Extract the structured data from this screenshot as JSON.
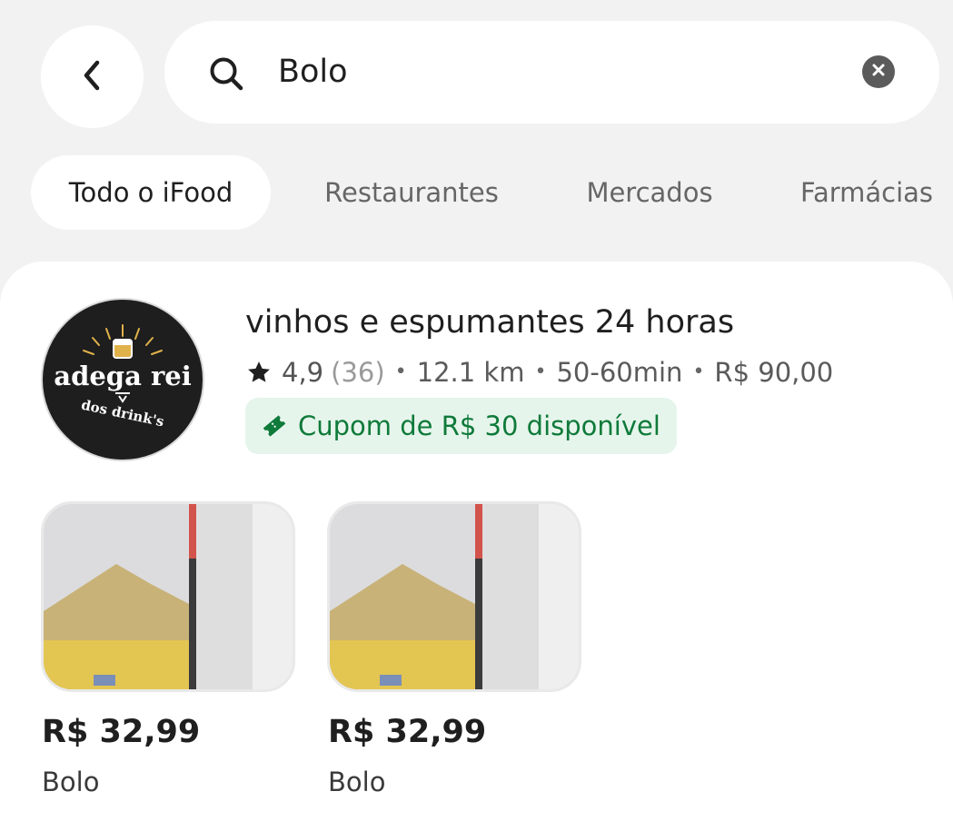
{
  "search": {
    "query": "Bolo"
  },
  "tabs": [
    "Todo o iFood",
    "Restaurantes",
    "Mercados",
    "Farmácias"
  ],
  "store": {
    "name": "vinhos e espumantes 24 horas",
    "logo_text_main": "adega rei",
    "logo_text_sub": "dos drink's",
    "rating": "4,9",
    "rating_count": "(36)",
    "distance": "12.1 km",
    "delivery_time": "50-60min",
    "minimum_order": "R$ 90,00",
    "coupon": "Cupom de R$ 30 disponível"
  },
  "products": [
    {
      "price": "R$ 32,99",
      "name": "Bolo"
    },
    {
      "price": "R$ 32,99",
      "name": "Bolo"
    }
  ],
  "icons": {
    "back": "chevron-left-icon",
    "search": "search-icon",
    "clear": "close-circle-icon",
    "star": "star-icon",
    "coupon": "ticket-icon"
  },
  "colors": {
    "background": "#f2f2f2",
    "card": "#ffffff",
    "coupon_bg": "#e6f5ec",
    "coupon_text": "#0f7a3a"
  }
}
